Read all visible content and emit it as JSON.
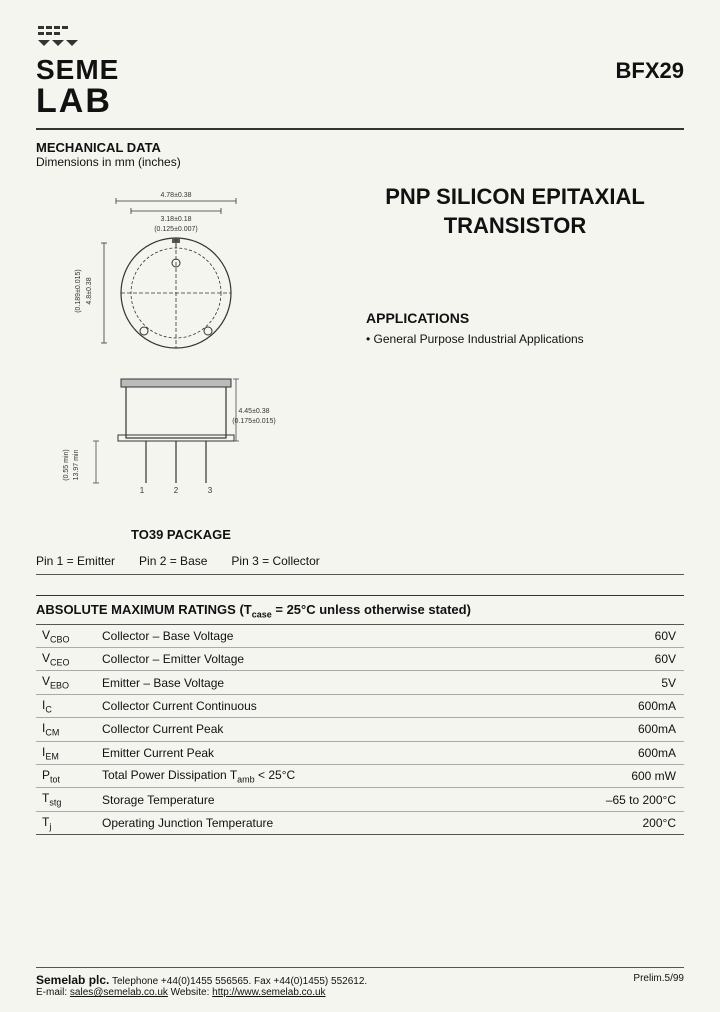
{
  "header": {
    "part_number": "BFX29",
    "logo_text_top": "SEME",
    "logo_text_bottom": "LAB"
  },
  "mechanical": {
    "title": "MECHANICAL DATA",
    "subtitle": "Dimensions in mm (inches)"
  },
  "transistor": {
    "title_line1": "PNP SILICON EPITAXIAL",
    "title_line2": "TRANSISTOR"
  },
  "applications": {
    "title": "APPLICATIONS",
    "items": [
      "General Purpose Industrial Applications"
    ]
  },
  "package": {
    "label": "TO39 PACKAGE"
  },
  "pins": {
    "text": "Pin 1 = Emitter     Pin 2 = Base     Pin 3 = Collector"
  },
  "ratings": {
    "header": "ABSOLUTE MAXIMUM RATINGS",
    "condition": "= 25°C unless otherwise stated)",
    "rows": [
      {
        "symbol": "V_CBO",
        "symbol_sub": "CBO",
        "description": "Collector – Base Voltage",
        "value": "60V"
      },
      {
        "symbol": "V_CEO",
        "symbol_sub": "CEO",
        "description": "Collector – Emitter Voltage",
        "value": "60V"
      },
      {
        "symbol": "V_EBO",
        "symbol_sub": "EBO",
        "description": "Emitter – Base Voltage",
        "value": "5V"
      },
      {
        "symbol": "I_C",
        "symbol_sub": "C",
        "description": "Collector Current Continuous",
        "value": "600mA"
      },
      {
        "symbol": "I_CM",
        "symbol_sub": "CM",
        "description": "Collector Current Peak",
        "value": "600mA"
      },
      {
        "symbol": "I_EM",
        "symbol_sub": "EM",
        "description": "Emitter Current Peak",
        "value": "600mA"
      },
      {
        "symbol": "P_tot",
        "symbol_sub": "tot",
        "description": "Total Power Dissipation T_amb < 25°C",
        "value": "600 mW"
      },
      {
        "symbol": "T_stg",
        "symbol_sub": "stg",
        "description": "Storage Temperature",
        "value": "–65 to 200°C"
      },
      {
        "symbol": "T_j",
        "symbol_sub": "j",
        "description": "Operating Junction Temperature",
        "value": "200°C"
      }
    ]
  },
  "footer": {
    "company": "Semelab plc.",
    "contact": "Telephone +44(0)1455 556565.  Fax +44(0)1455) 552612.",
    "email_label": "E-mail:",
    "email": "sales@semelab.co.uk",
    "website_label": "Website:",
    "website": "http://www.semelab.co.uk",
    "prelim": "Prelim.5/99"
  }
}
